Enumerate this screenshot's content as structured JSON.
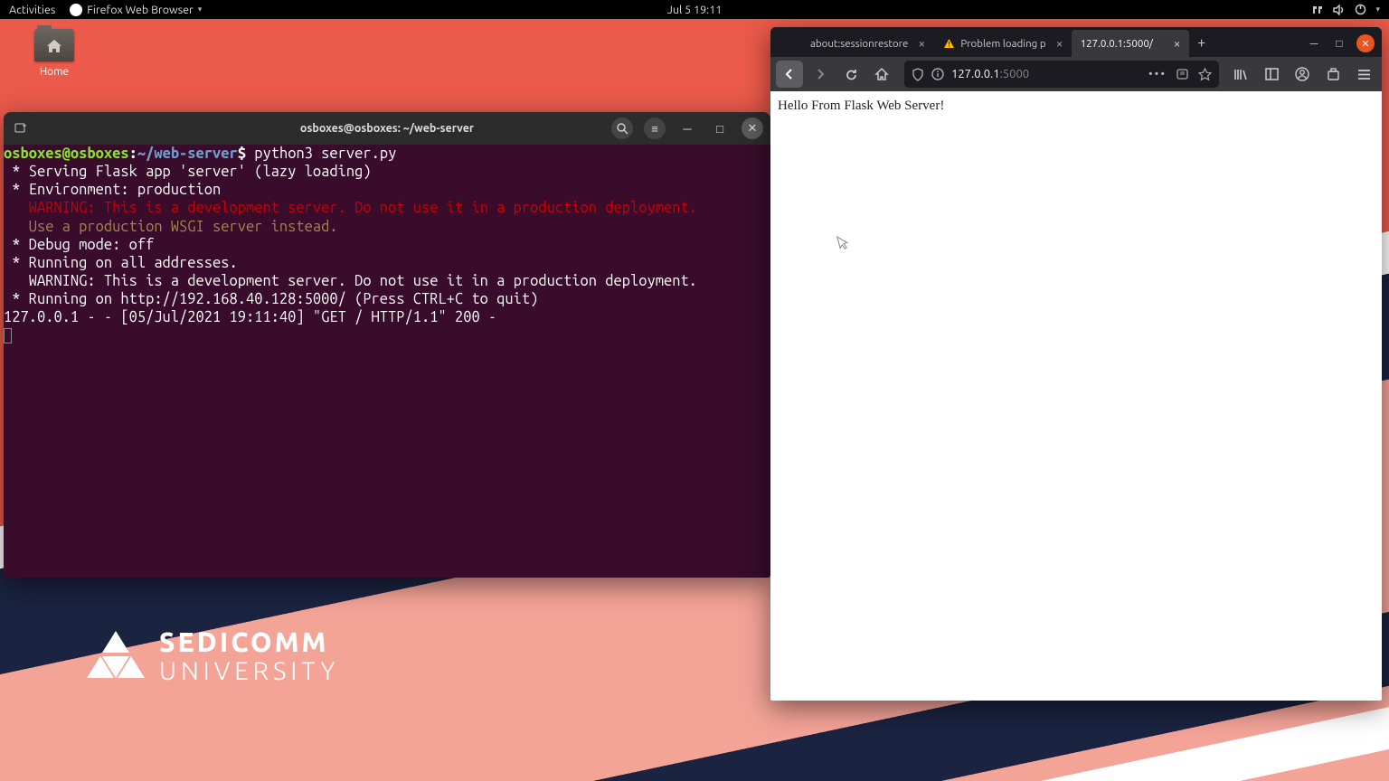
{
  "topbar": {
    "activities": "Activities",
    "app_label": "Firefox Web Browser",
    "clock": "Jul 5  19:11"
  },
  "desktop": {
    "home_label": "Home"
  },
  "terminal": {
    "title": "osboxes@osboxes: ~/web-server",
    "prompt_user": "osboxes@osboxes",
    "prompt_sep": ":",
    "prompt_path": "~/web-server",
    "prompt_dollar": "$",
    "cmd": " python3 server.py",
    "lines": {
      "l1": " * Serving Flask app 'server' (lazy loading)",
      "l2": " * Environment: production",
      "l3": "   WARNING: This is a development server. Do not use it in a production deployment.",
      "l4": "   Use a production WSGI server instead.",
      "l5": " * Debug mode: off",
      "l6": " * Running on all addresses.",
      "l7": "   WARNING: This is a development server. Do not use it in a production deployment.",
      "l8": " * Running on http://192.168.40.128:5000/ (Press CTRL+C to quit)",
      "l9": "127.0.0.1 - - [05/Jul/2021 19:11:40] \"GET / HTTP/1.1\" 200 -"
    }
  },
  "logo": {
    "line1": "SEDICOMM",
    "line2": "UNIVERSITY"
  },
  "firefox": {
    "tabs": [
      {
        "label": "about:sessionrestore"
      },
      {
        "label": "Problem loading p"
      },
      {
        "label": "127.0.0.1:5000/"
      }
    ],
    "url_host": "127.0.0.1",
    "url_port": ":5000",
    "page_text": "Hello From Flask Web Server!"
  }
}
